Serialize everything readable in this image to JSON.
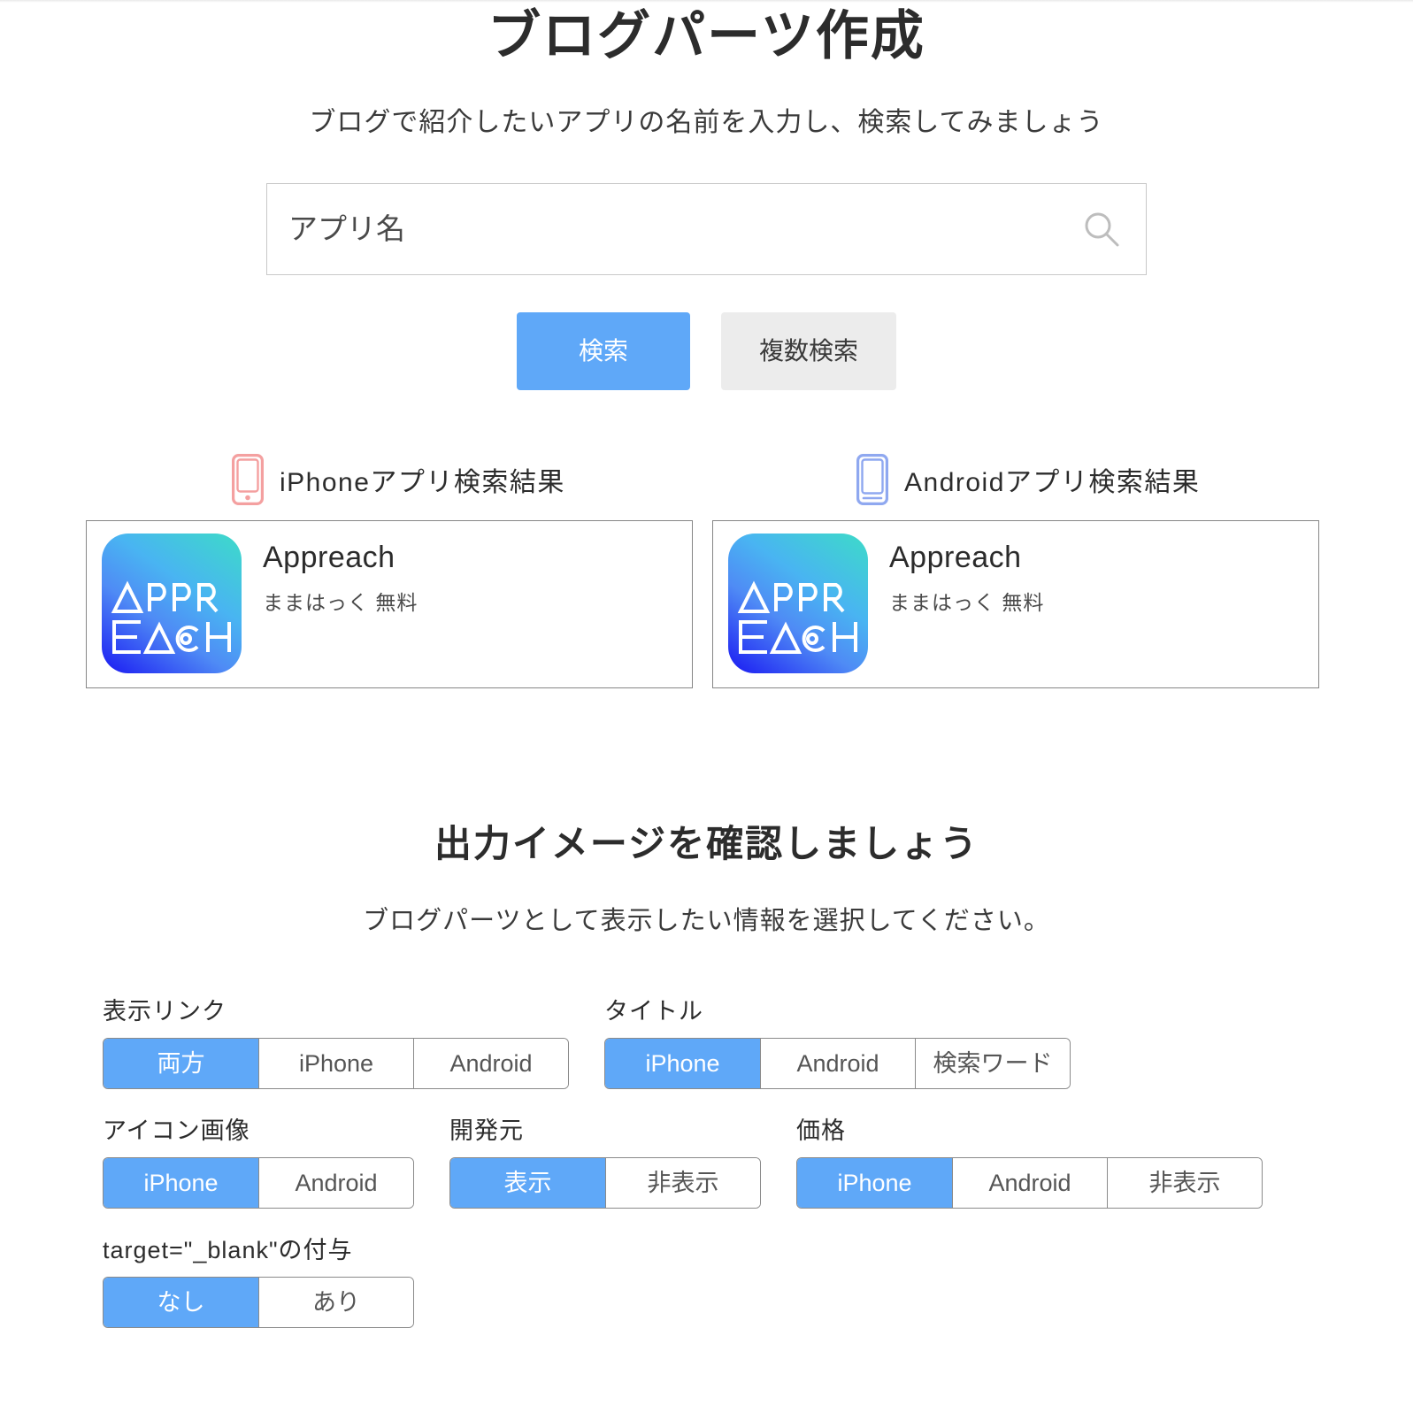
{
  "header": {
    "title": "ブログパーツ作成",
    "subtitle": "ブログで紹介したいアプリの名前を入力し、検索してみましょう"
  },
  "search": {
    "placeholder": "アプリ名",
    "value": "",
    "icon": "search-icon",
    "submit_label": "検索",
    "multi_label": "複数検索"
  },
  "colors": {
    "accent": "#5fa8f8",
    "secondary_button": "#ececec",
    "iphone_icon": "#f4a0a0",
    "android_icon": "#8fa8f0",
    "border": "#8a8a8a"
  },
  "results": {
    "iphone": {
      "icon": "iphone-icon",
      "heading": "iPhoneアプリ検索結果",
      "app": {
        "name": "Appreach",
        "developer_price": "ままはっく 無料",
        "icon_text_line1": "△PPR",
        "icon_text_line2": "E△CH"
      }
    },
    "android": {
      "icon": "android-icon",
      "heading": "Androidアプリ検索結果",
      "app": {
        "name": "Appreach",
        "developer_price": "ままはっく 無料",
        "icon_text_line1": "△PPR",
        "icon_text_line2": "E△CH"
      }
    }
  },
  "output_section": {
    "title": "出力イメージを確認しましょう",
    "subtitle": "ブログパーツとして表示したい情報を選択してください。",
    "rows": [
      [
        {
          "label": "表示リンク",
          "options": [
            "両方",
            "iPhone",
            "Android"
          ],
          "selected": 0
        },
        {
          "label": "タイトル",
          "options": [
            "iPhone",
            "Android",
            "検索ワード"
          ],
          "selected": 0
        }
      ],
      [
        {
          "label": "アイコン画像",
          "options": [
            "iPhone",
            "Android"
          ],
          "selected": 0
        },
        {
          "label": "開発元",
          "options": [
            "表示",
            "非表示"
          ],
          "selected": 0
        },
        {
          "label": "価格",
          "options": [
            "iPhone",
            "Android",
            "非表示"
          ],
          "selected": 0
        }
      ],
      [
        {
          "label": "target=\"_blank\"の付与",
          "options": [
            "なし",
            "あり"
          ],
          "selected": 0
        }
      ]
    ]
  }
}
